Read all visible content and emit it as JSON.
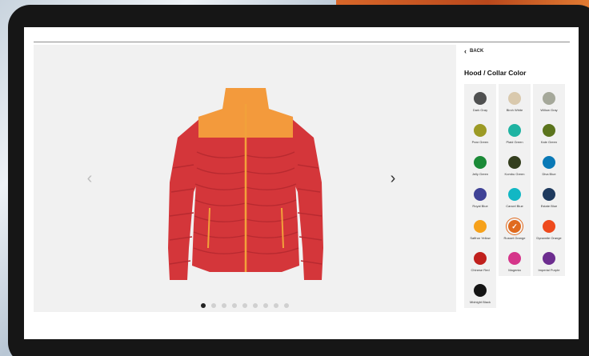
{
  "viewer": {
    "prev_label": "‹",
    "next_label": "›",
    "image_count": 9,
    "active_image": 0
  },
  "panel": {
    "back_label": "BACK",
    "title": "Hood / Collar Color",
    "selected_color": "Russet Orange"
  },
  "colors": [
    {
      "name": "Dark Gray",
      "hex": "#4f5050"
    },
    {
      "name": "Birch White",
      "hex": "#d9c9ad"
    },
    {
      "name": "Willow Gray",
      "hex": "#a5a89a"
    },
    {
      "name": "Pear Green",
      "hex": "#9c9a25"
    },
    {
      "name": "Plaid Green",
      "hex": "#1fb3a2"
    },
    {
      "name": "Kale Green",
      "hex": "#5b741d"
    },
    {
      "name": "Jelly Green",
      "hex": "#1b8a37"
    },
    {
      "name": "Kombu Green",
      "hex": "#343e1e"
    },
    {
      "name": "Diva Blue",
      "hex": "#0a79b6"
    },
    {
      "name": "Royal Blue",
      "hex": "#3f4296"
    },
    {
      "name": "Cancel Blue",
      "hex": "#12b7c4"
    },
    {
      "name": "Estate Blue",
      "hex": "#1f3a5e"
    },
    {
      "name": "Saffron Yellow",
      "hex": "#f6a11b"
    },
    {
      "name": "Russet Orange",
      "hex": "#e06a1e"
    },
    {
      "name": "Dynamite Orange",
      "hex": "#ee4a1d"
    },
    {
      "name": "Chinese Red",
      "hex": "#c0201d"
    },
    {
      "name": "Magenta",
      "hex": "#d5358a"
    },
    {
      "name": "Imperial Purple",
      "hex": "#6c2d8f"
    },
    {
      "name": "Midnight Black",
      "hex": "#141414"
    }
  ],
  "jacket": {
    "body_color": "#d4363a",
    "body_shade": "#b82a30",
    "collar_color": "#f39a3c",
    "zip_color": "#f2a13a"
  }
}
